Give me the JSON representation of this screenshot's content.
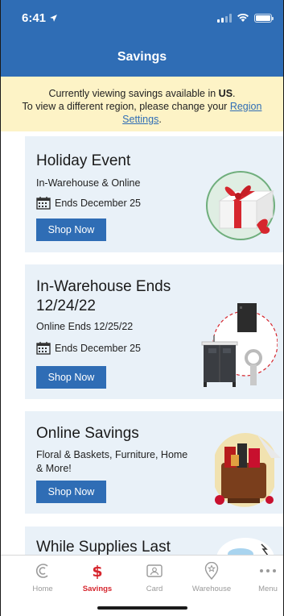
{
  "status": {
    "time": "6:41"
  },
  "header": {
    "title": "Savings"
  },
  "notice": {
    "line1_prefix": "Currently viewing savings available in ",
    "region": "US",
    "line1_suffix": ".",
    "line2_prefix": "To view a different region, please change your ",
    "link_label": "Region Settings",
    "line2_suffix": "."
  },
  "cards": [
    {
      "title": "Holiday Event",
      "subtitle": "In-Warehouse & Online",
      "ends": "Ends December 25",
      "button": "Shop Now",
      "image_icon": "gift-box-icon"
    },
    {
      "title": "In-Warehouse Ends 12/24/22",
      "subtitle": "Online Ends 12/25/22",
      "ends": "Ends December 25",
      "button": "Shop Now",
      "image_icon": "furniture-appliances-icon"
    },
    {
      "title": "Online Savings",
      "subtitle": "Floral & Baskets, Furniture, Home & More!",
      "button": "Shop Now",
      "image_icon": "gift-basket-icon"
    },
    {
      "title": "While Supplies Last",
      "image_icon": "product-icon"
    }
  ],
  "tabs": [
    {
      "label": "Home",
      "icon": "home-icon"
    },
    {
      "label": "Savings",
      "icon": "dollar-icon"
    },
    {
      "label": "Card",
      "icon": "card-icon"
    },
    {
      "label": "Warehouse",
      "icon": "warehouse-pin-icon"
    },
    {
      "label": "Menu",
      "icon": "more-dots-icon"
    }
  ],
  "colors": {
    "header_blue": "#2f6db5",
    "notice_yellow": "#fdf3c6",
    "card_bg": "#e9f1f8",
    "active_red": "#d6262e"
  }
}
